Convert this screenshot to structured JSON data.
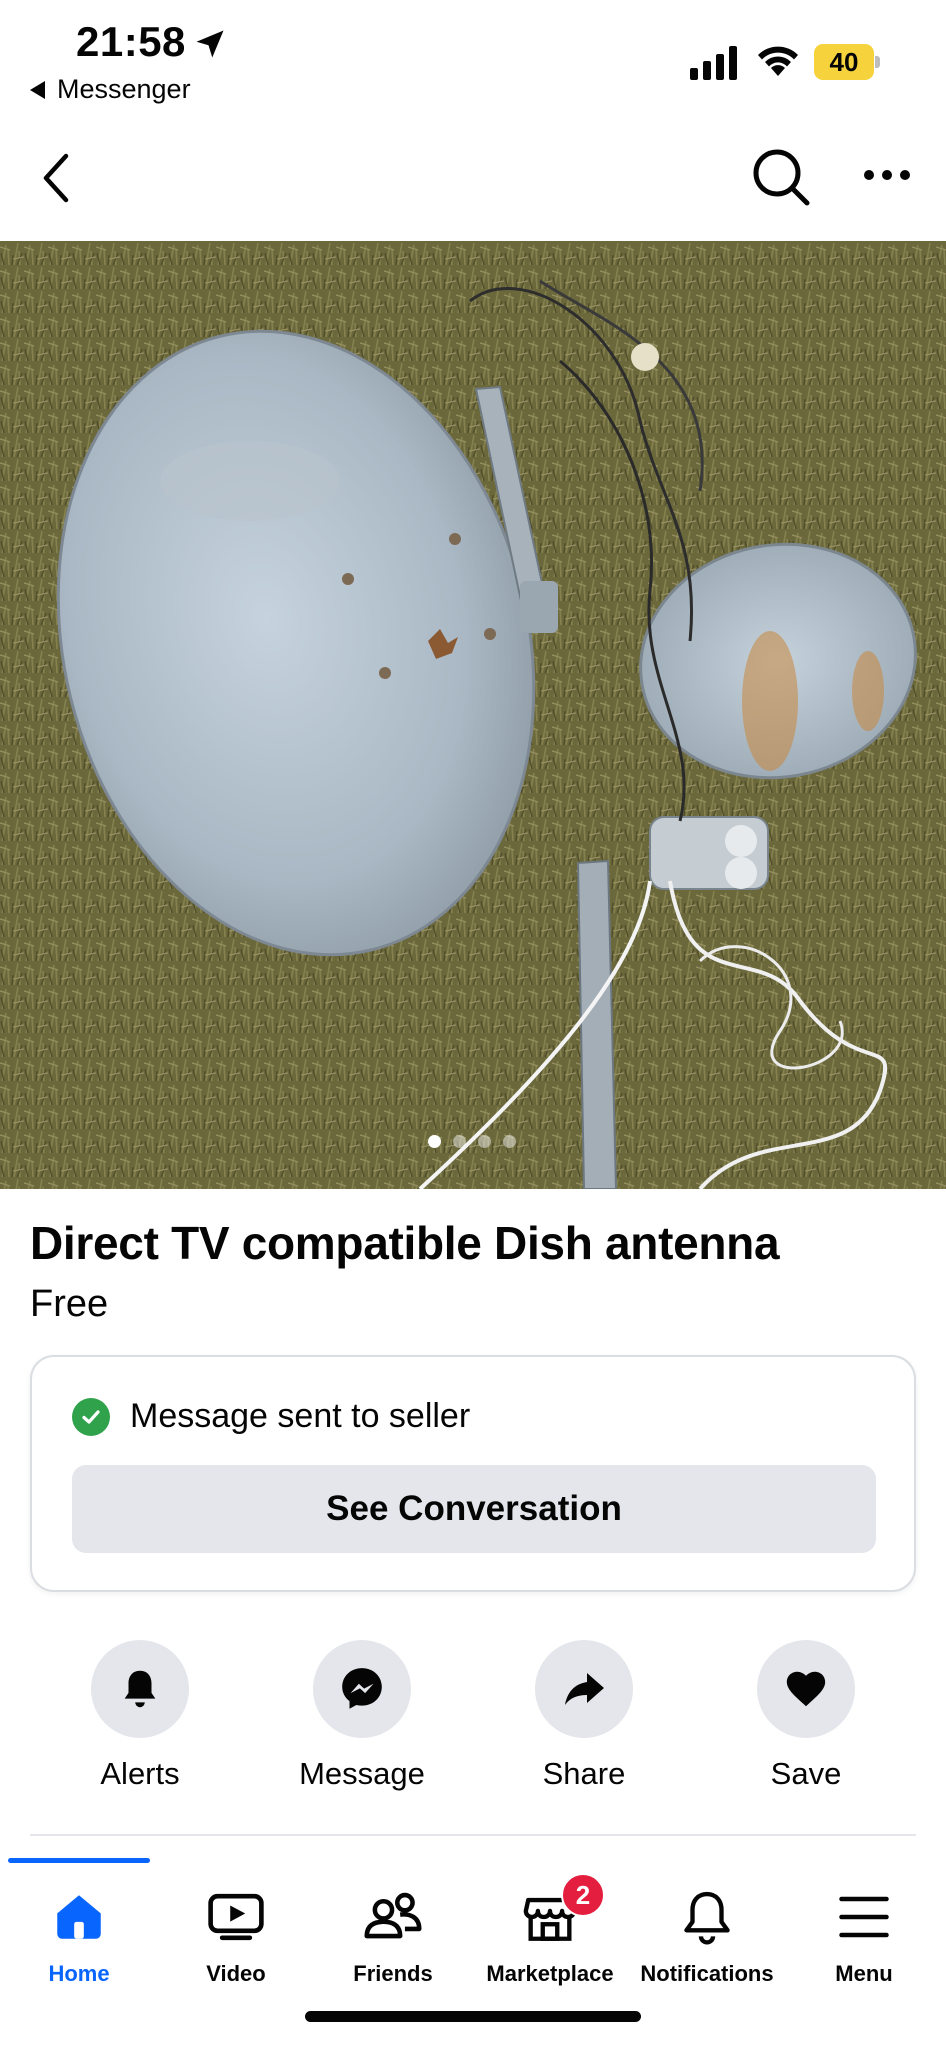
{
  "status_bar": {
    "time": "21:58",
    "back_app": "Messenger",
    "battery": "40",
    "icons": [
      "location-arrow-icon",
      "signal-icon",
      "wifi-icon",
      "battery-icon"
    ]
  },
  "nav": {
    "icons": [
      "back-chevron-icon",
      "search-icon",
      "more-icon"
    ]
  },
  "photo": {
    "subject": "listing-photo",
    "page_count": 4,
    "active_page": 1
  },
  "listing": {
    "title": "Direct TV compatible Dish antenna",
    "price": "Free"
  },
  "message_card": {
    "status_text": "Message sent to seller",
    "button_label": "See Conversation"
  },
  "actions": [
    {
      "label": "Alerts",
      "icon": "bell-icon"
    },
    {
      "label": "Message",
      "icon": "messenger-icon"
    },
    {
      "label": "Share",
      "icon": "share-arrow-icon"
    },
    {
      "label": "Save",
      "icon": "heart-icon"
    }
  ],
  "tabs": [
    {
      "label": "Home",
      "icon": "home-icon",
      "active": true
    },
    {
      "label": "Video",
      "icon": "video-icon",
      "active": false
    },
    {
      "label": "Friends",
      "icon": "friends-icon",
      "active": false
    },
    {
      "label": "Marketplace",
      "icon": "marketplace-icon",
      "active": false,
      "badge": "2"
    },
    {
      "label": "Notifications",
      "icon": "bell-outline-icon",
      "active": false
    },
    {
      "label": "Menu",
      "icon": "hamburger-icon",
      "active": false
    }
  ],
  "colors": {
    "accent": "#0866ff",
    "success": "#31a24c",
    "badge": "#e41e3f",
    "button_bg": "#e4e6eb",
    "battery": "#f6d33c"
  }
}
